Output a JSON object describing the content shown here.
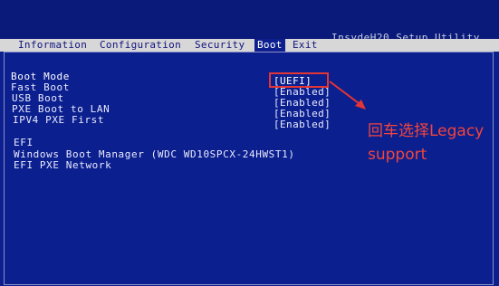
{
  "bios": {
    "title": "InsydeH20 Setup Utility",
    "tabs": [
      {
        "label": "Information"
      },
      {
        "label": "Configuration"
      },
      {
        "label": "Security"
      },
      {
        "label": "Boot"
      },
      {
        "label": "Exit"
      }
    ],
    "active_tab": "Boot",
    "settings": [
      {
        "label": "Boot Mode",
        "value": "[UEFI]"
      },
      {
        "label": "Fast Boot",
        "value": "[Enabled]"
      },
      {
        "label": "USB Boot",
        "value": "[Enabled]"
      },
      {
        "label": "PXE Boot to LAN",
        "value": "[Enabled]"
      },
      {
        "label": "IPV4 PXE First",
        "value": "[Enabled]"
      }
    ],
    "efi_heading": "EFI",
    "efi_entries": [
      {
        "label": "Windows Boot Manager (WDC WD10SPCX-24HWST1)"
      },
      {
        "label": "EFI PXE Network"
      }
    ]
  },
  "annotation": {
    "line1": "回车选择Legacy",
    "line2": "support",
    "color": "#f2453d"
  },
  "colors": {
    "bios_background": "#0c1f8e",
    "menubar": "#d7d7d7",
    "text": "#e8ebff",
    "highlight": "#e33535"
  }
}
